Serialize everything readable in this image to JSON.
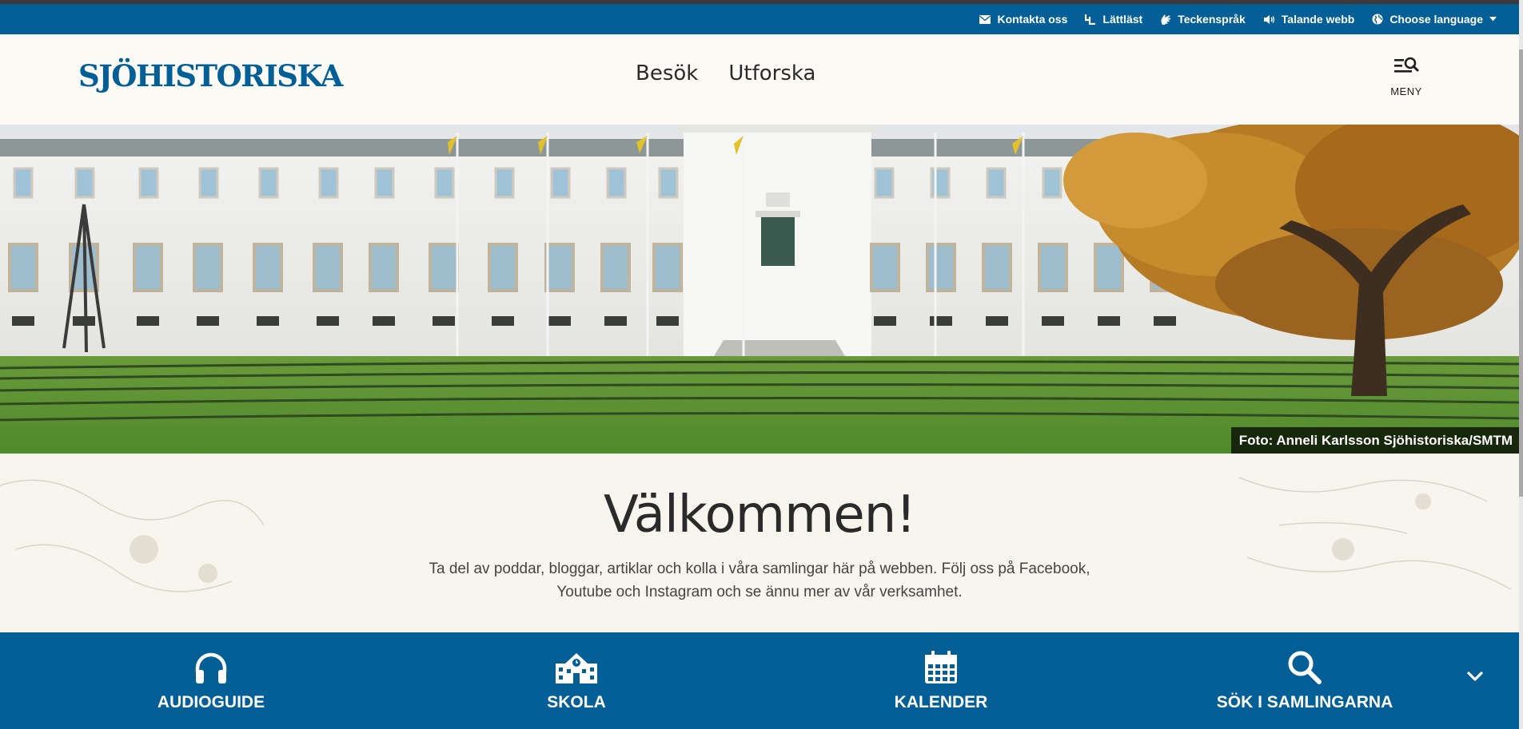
{
  "utility_bar": {
    "items": [
      {
        "label": "Kontakta oss",
        "icon": "mail-icon"
      },
      {
        "label": "Lättläst",
        "icon": "easy-read-icon"
      },
      {
        "label": "Teckenspråk",
        "icon": "sign-language-icon"
      },
      {
        "label": "Talande webb",
        "icon": "speaker-icon"
      },
      {
        "label": "Choose language",
        "icon": "globe-icon"
      }
    ],
    "background": "#045f96"
  },
  "header": {
    "logo": "SJÖHISTORISKA",
    "nav": [
      "Besök",
      "Utforska"
    ],
    "menu_label": "MENY"
  },
  "hero": {
    "photo_credit": "Foto: Anneli Karlsson Sjöhistoriska/SMTM"
  },
  "welcome": {
    "title": "Välkommen!",
    "text": "Ta del av poddar, bloggar, artiklar och kolla i våra samlingar här på webben. Följ oss på Facebook, Youtube och Instagram och se ännu mer av vår verksamhet."
  },
  "quick_links": [
    {
      "label": "AUDIOGUIDE",
      "icon": "headphones-icon"
    },
    {
      "label": "SKOLA",
      "icon": "school-icon"
    },
    {
      "label": "KALENDER",
      "icon": "calendar-icon"
    },
    {
      "label": "SÖK I SAMLINGARNA",
      "icon": "search-icon"
    }
  ],
  "colors": {
    "brand_blue": "#045f96",
    "header_bg": "#fbfaf5",
    "text_dark": "#2a2a2a"
  }
}
